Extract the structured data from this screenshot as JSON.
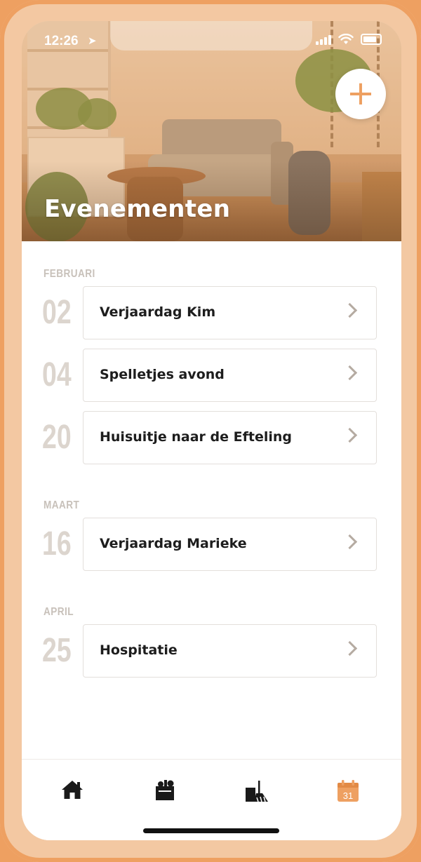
{
  "status_bar": {
    "time": "12:26",
    "location_icon": "location-arrow-icon",
    "wifi_icon": "wifi-icon",
    "signal_icon": "signal-icon",
    "battery_icon": "battery-icon"
  },
  "header": {
    "title": "Evenementen",
    "add_label": "+",
    "add_icon": "plus-icon"
  },
  "events": {
    "groups": [
      {
        "month": "FEBRUARI",
        "items": [
          {
            "day": "02",
            "title": "Verjaardag Kim"
          },
          {
            "day": "04",
            "title": "Spelletjes avond"
          },
          {
            "day": "20",
            "title": "Huisuitje naar de Efteling"
          }
        ]
      },
      {
        "month": "MAART",
        "items": [
          {
            "day": "16",
            "title": "Verjaardag Marieke"
          }
        ]
      },
      {
        "month": "APRIL",
        "items": [
          {
            "day": "25",
            "title": "Hospitatie"
          }
        ]
      }
    ]
  },
  "tab_bar": {
    "tabs": [
      {
        "icon": "home-icon",
        "active": false
      },
      {
        "icon": "groceries-bag-icon",
        "active": false
      },
      {
        "icon": "cleaning-icon",
        "active": false
      },
      {
        "icon": "calendar-icon",
        "active": true,
        "calendar_day": "31"
      }
    ]
  },
  "colors": {
    "accent": "#eea061",
    "device_frame": "#f3c8a2",
    "muted_text": "#c8c1ba",
    "day_number": "#dcd5ce",
    "chevron": "#b5aba2",
    "tab_icon": "#1a1a1a"
  }
}
